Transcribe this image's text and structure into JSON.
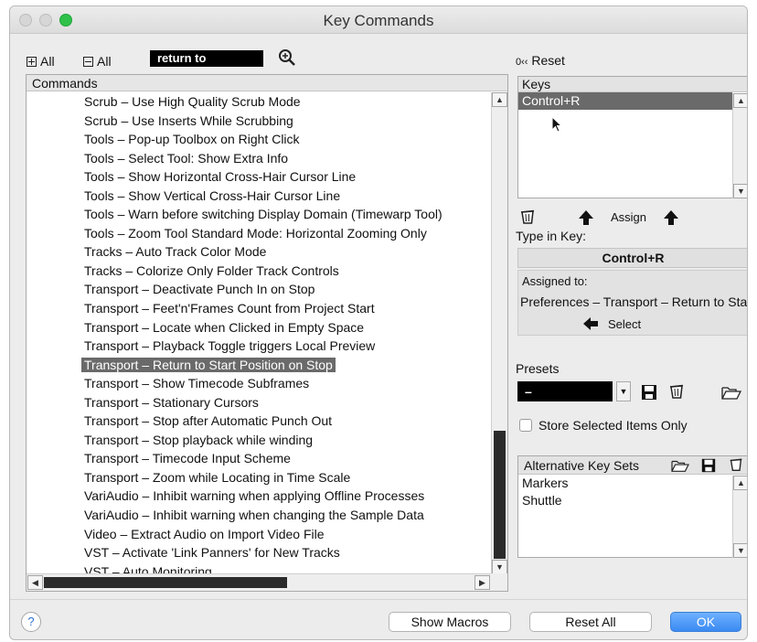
{
  "window": {
    "title": "Key Commands"
  },
  "toolbar": {
    "expand_all_label": "All",
    "collapse_all_label": "All",
    "search_value": "return to",
    "search_icon": "magnifier-search-icon"
  },
  "commands": {
    "header": "Commands",
    "items": [
      "Scrub – Use High Quality Scrub Mode",
      "Scrub – Use Inserts While Scrubbing",
      "Tools – Pop-up Toolbox on Right Click",
      "Tools – Select Tool: Show Extra Info",
      "Tools – Show Horizontal Cross-Hair Cursor Line",
      "Tools – Show Vertical Cross-Hair Cursor Line",
      "Tools – Warn before switching Display Domain (Timewarp Tool)",
      "Tools – Zoom Tool Standard Mode: Horizontal Zooming Only",
      "Tracks – Auto Track Color Mode",
      "Tracks – Colorize Only Folder Track Controls",
      "Transport – Deactivate Punch In on Stop",
      "Transport – Feet'n'Frames Count from Project Start",
      "Transport – Locate when Clicked in Empty Space",
      "Transport – Playback Toggle triggers Local Preview",
      "Transport – Return to Start Position on Stop",
      "Transport – Show Timecode Subframes",
      "Transport – Stationary Cursors",
      "Transport – Stop after Automatic Punch Out",
      "Transport – Stop playback while winding",
      "Transport – Timecode Input Scheme",
      "Transport – Zoom while Locating in Time Scale",
      "VariAudio – Inhibit warning when applying Offline Processes",
      "VariAudio – Inhibit warning when changing the Sample Data",
      "Video – Extract Audio on Import Video File",
      "VST – Activate 'Link Panners' for New Tracks",
      "VST – Auto Monitoring"
    ],
    "selected_index": 14
  },
  "reset": {
    "label": "Reset"
  },
  "keys": {
    "header": "Keys",
    "items": [
      "Control+R"
    ]
  },
  "assign": {
    "label": "Assign"
  },
  "type_in": {
    "label": "Type in Key:",
    "value": "Control+R"
  },
  "assigned": {
    "label": "Assigned to:",
    "value": "Preferences – Transport – Return to Start Position on Stop",
    "select_label": "Select"
  },
  "presets": {
    "label": "Presets",
    "value": "–"
  },
  "store_selected": {
    "label": "Store Selected Items Only",
    "checked": false
  },
  "alt_key_sets": {
    "header": "Alternative Key Sets",
    "items": [
      "Markers",
      "Shuttle"
    ]
  },
  "footer": {
    "help": "?",
    "show_macros": "Show Macros",
    "reset_all": "Reset All",
    "ok": "OK"
  },
  "colors": {
    "accent": "#3a8af2",
    "selection": "#6a6a6a",
    "traffic_green": "#2fc14a"
  }
}
